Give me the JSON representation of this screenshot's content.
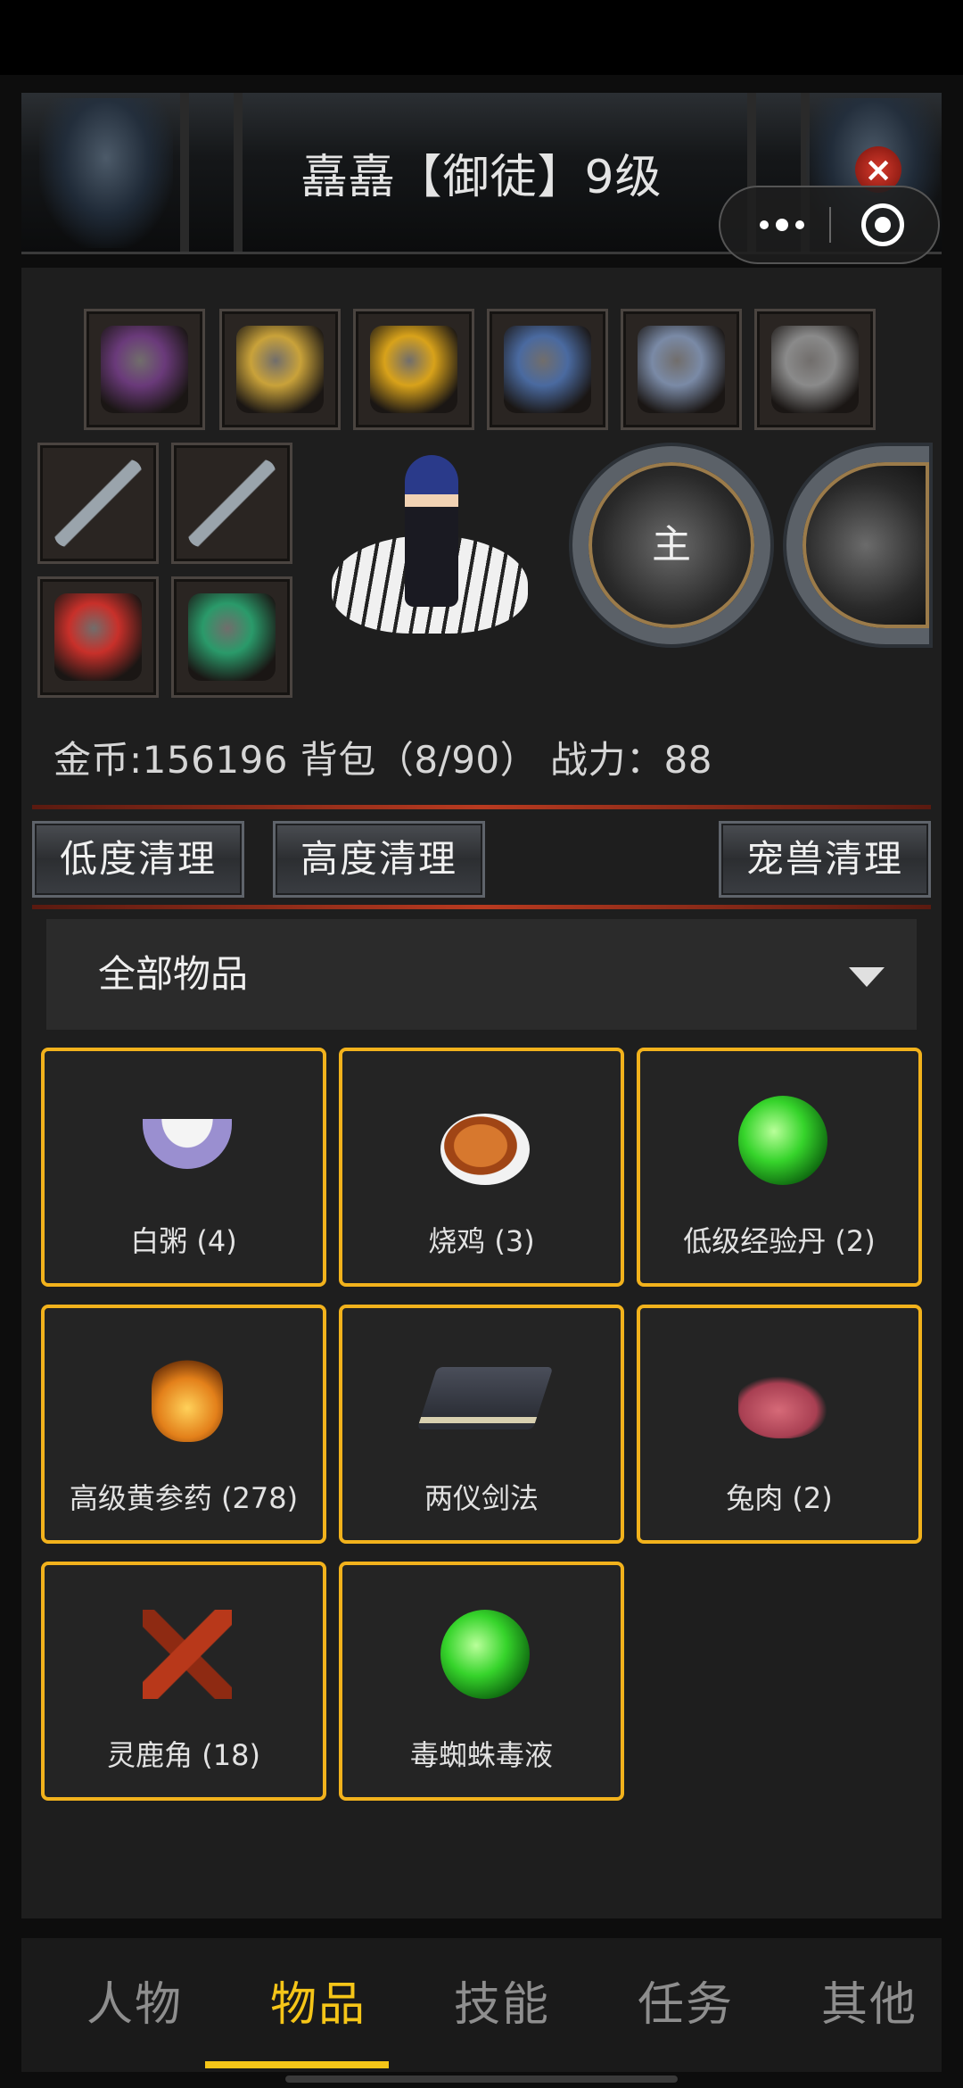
{
  "header": {
    "title": "嚞嚞【御徒】9级"
  },
  "equipment": [
    {
      "icon": "cape-icon",
      "color": "#6a3a7a"
    },
    {
      "icon": "armor-icon",
      "color": "#c9a23a"
    },
    {
      "icon": "amulet-icon",
      "color": "#d8a21a"
    },
    {
      "icon": "bracer-icon",
      "color": "#4a6aa0"
    },
    {
      "icon": "boots-icon",
      "color": "#7a8aa6"
    },
    {
      "icon": "ring-icon",
      "color": "#8a8a8a"
    },
    {
      "icon": "sword-icon",
      "color": "#9aa4ac"
    },
    {
      "icon": "sword-icon",
      "color": "#9aa4ac"
    },
    {
      "icon": "bracelet-icon",
      "color": "#c8302a"
    },
    {
      "icon": "jade-icon",
      "color": "#2a9a6a"
    }
  ],
  "pets": [
    {
      "label": "主"
    },
    {
      "label": ""
    }
  ],
  "stats": {
    "text": "金币:156196 背包（8/90） 战力：88"
  },
  "actions": {
    "low_clean": "低度清理",
    "high_clean": "高度清理",
    "pet_clean": "宠兽清理"
  },
  "filter": {
    "selected": "全部物品"
  },
  "items": [
    {
      "name": "白粥 (4)",
      "icon": "porridge-icon"
    },
    {
      "name": "烧鸡 (3)",
      "icon": "chicken-icon"
    },
    {
      "name": "低级经验丹 (2)",
      "icon": "orb-green-icon"
    },
    {
      "name": "高级黄参药 (278)",
      "icon": "bottle-icon"
    },
    {
      "name": "两仪剑法",
      "icon": "book-icon"
    },
    {
      "name": "兔肉 (2)",
      "icon": "meat-icon"
    },
    {
      "name": "灵鹿角 (18)",
      "icon": "antler-icon"
    },
    {
      "name": "毒蜘蛛毒液",
      "icon": "orb-green-icon"
    }
  ],
  "nav": {
    "tabs": [
      "人物",
      "物品",
      "技能",
      "任务",
      "其他"
    ],
    "active_index": 1
  },
  "colors": {
    "accent": "#f5c518",
    "card_border": "#f2b21c",
    "background": "#1e1e1e"
  }
}
